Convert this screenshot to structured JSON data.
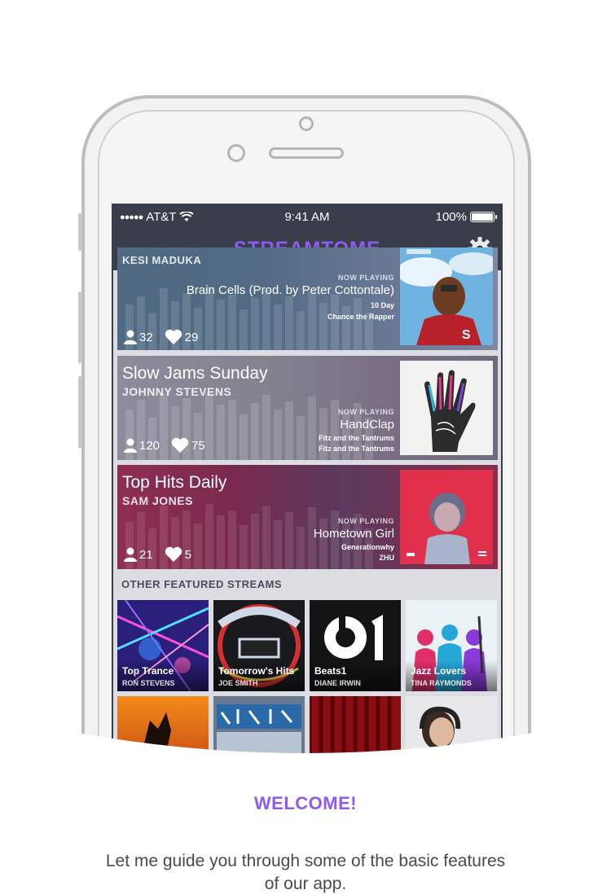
{
  "status_bar": {
    "carrier": "AT&T",
    "time": "9:41 AM",
    "battery": "100%",
    "signal_dots": "●●●●●"
  },
  "header": {
    "logo_text": "STREAMTOME",
    "settings_icon": "gear-icon"
  },
  "streams": [
    {
      "title": "",
      "host": "KESI MADUKA",
      "now_playing_label": "NOW PLAYING",
      "song": "Brain Cells (Prod. by Peter Cottontale)",
      "meta1": "10 Day",
      "meta2": "Chance the Rapper",
      "listeners": "32",
      "likes": "29",
      "accent": "#4a6a8a"
    },
    {
      "title": "Slow Jams Sunday",
      "host": "JOHNNY STEVENS",
      "now_playing_label": "NOW PLAYING",
      "song": "HandClap",
      "meta1": "Fitz and the Tantrums",
      "meta2": "Fitz and the Tantrums",
      "listeners": "120",
      "likes": "75",
      "accent": "#6a5a7a"
    },
    {
      "title": "Top Hits Daily",
      "host": "SAM JONES",
      "now_playing_label": "NOW PLAYING",
      "song": "Hometown Girl",
      "meta1": "Generationwhy",
      "meta2": "ZHU",
      "listeners": "21",
      "likes": "5",
      "accent": "#8a2a4a"
    }
  ],
  "featured": {
    "header": "OTHER FEATURED STREAMS",
    "tiles": [
      {
        "title": "Top Trance",
        "host": "RON STEVENS"
      },
      {
        "title": "Tomorrow's Hits",
        "host": "JOE SMITH"
      },
      {
        "title": "Beats1",
        "host": "DIANE IRWIN"
      },
      {
        "title": "Jazz Lovers",
        "host": "TINA RAYMONDS"
      }
    ],
    "beats_logo": "b1"
  },
  "onboarding": {
    "heading": "WELCOME!",
    "body": "Let me guide you through some of the basic features of our app."
  },
  "colors": {
    "brand": "#8d5ced",
    "nav": "#3a3d4a"
  }
}
